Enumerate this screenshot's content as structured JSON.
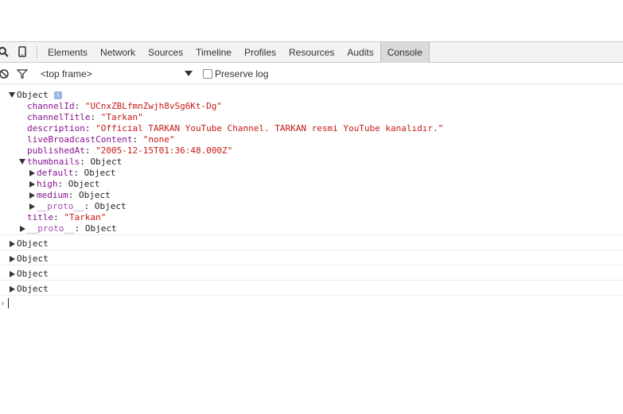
{
  "devtools": {
    "tabs": [
      "Elements",
      "Network",
      "Sources",
      "Timeline",
      "Profiles",
      "Resources",
      "Audits",
      "Console"
    ],
    "active_tab": "Console",
    "icons": [
      "search-icon",
      "device-mode-icon",
      "clear-console-icon",
      "filter-icon"
    ]
  },
  "filterbar": {
    "frame": "<top frame>",
    "preserve_log_label": "Preserve log",
    "preserve_log_checked": false
  },
  "console": {
    "expanded_object": {
      "label": "Object",
      "info_badge": "i",
      "props": [
        {
          "key": "channelId",
          "value": "\"UCnxZBLfmnZwjh8vSg6Kt-Dg\""
        },
        {
          "key": "channelTitle",
          "value": "\"Tarkan\""
        },
        {
          "key": "description",
          "value": "\"Official TARKAN YouTube Channel. TARKAN resmi YouTube kanalıdır.\""
        },
        {
          "key": "liveBroadcastContent",
          "value": "\"none\""
        },
        {
          "key": "publishedAt",
          "value": "\"2005-12-15T01:36:48.000Z\""
        }
      ],
      "thumbnails": {
        "key": "thumbnails",
        "value": "Object",
        "children": [
          {
            "key": "default",
            "value": "Object"
          },
          {
            "key": "high",
            "value": "Object"
          },
          {
            "key": "medium",
            "value": "Object"
          },
          {
            "key": "__proto__",
            "value": "Object"
          }
        ]
      },
      "title": {
        "key": "title",
        "value": "\"Tarkan\""
      },
      "proto": {
        "key": "__proto__",
        "value": "Object"
      }
    },
    "collapsed_objects": [
      "Object",
      "Object",
      "Object",
      "Object"
    ],
    "prompt": "›"
  }
}
